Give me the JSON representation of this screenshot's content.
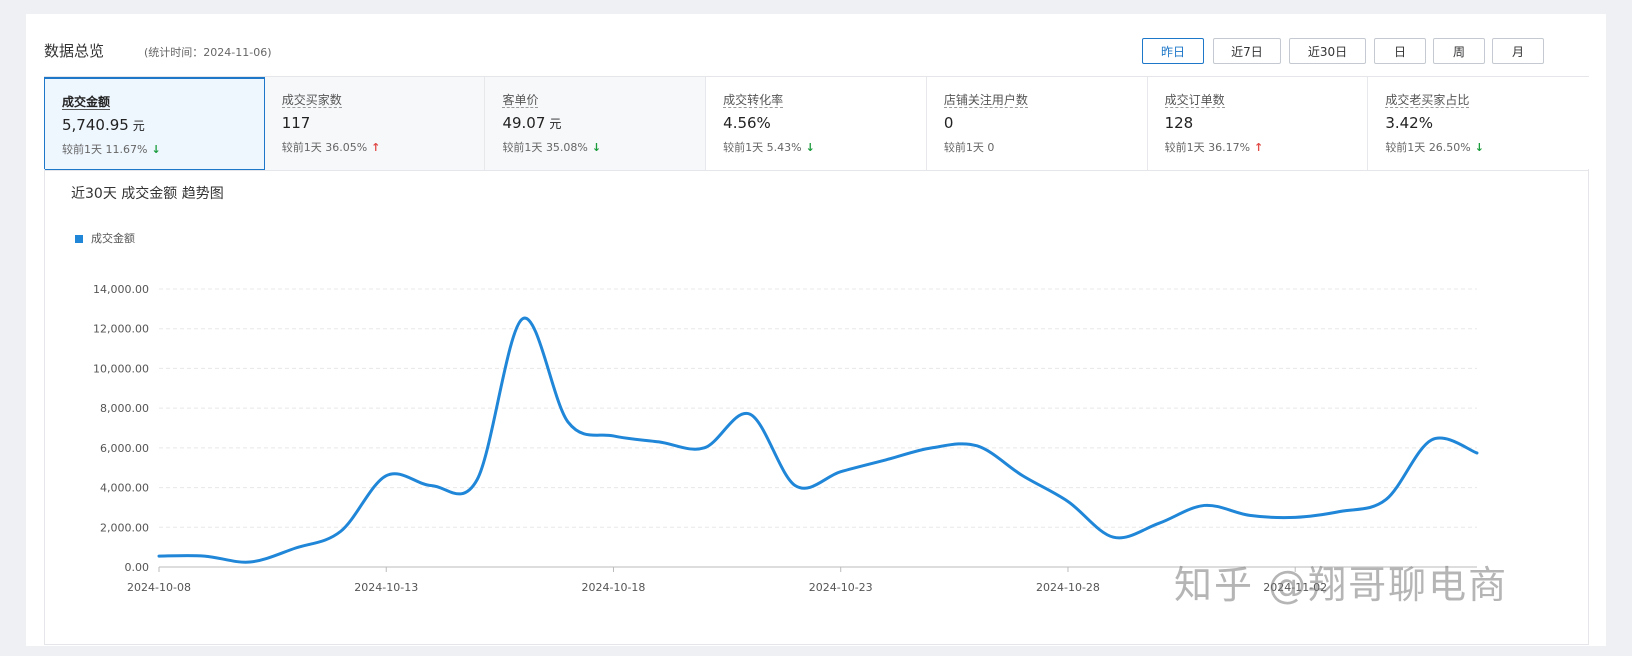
{
  "header": {
    "title": "数据总览",
    "subtitle": "(统计时间：2024-11-06)"
  },
  "range_buttons": [
    {
      "label": "昨日",
      "active": true
    },
    {
      "label": "近7日"
    },
    {
      "label": "近30日"
    },
    {
      "label": "日"
    },
    {
      "label": "周"
    },
    {
      "label": "月"
    }
  ],
  "metrics": [
    {
      "label": "成交金额",
      "value": "5,740.95",
      "unit": "元",
      "compare_prefix": "较前1天",
      "compare": "11.67%",
      "trend": "down",
      "active": true
    },
    {
      "label": "成交买家数",
      "value": "117",
      "unit": "",
      "compare_prefix": "较前1天",
      "compare": "36.05%",
      "trend": "up"
    },
    {
      "label": "客单价",
      "value": "49.07",
      "unit": "元",
      "compare_prefix": "较前1天",
      "compare": "35.08%",
      "trend": "down"
    },
    {
      "label": "成交转化率",
      "value": "4.56%",
      "unit": "",
      "compare_prefix": "较前1天",
      "compare": "5.43%",
      "trend": "down"
    },
    {
      "label": "店铺关注用户数",
      "value": "0",
      "unit": "",
      "compare_prefix": "较前1天",
      "compare": "0",
      "trend": "none"
    },
    {
      "label": "成交订单数",
      "value": "128",
      "unit": "",
      "compare_prefix": "较前1天",
      "compare": "36.17%",
      "trend": "up"
    },
    {
      "label": "成交老买家占比",
      "value": "3.42%",
      "unit": "",
      "compare_prefix": "较前1天",
      "compare": "26.50%",
      "trend": "down"
    }
  ],
  "icons": {
    "down": "arrow-down-icon",
    "up": "arrow-up-icon"
  },
  "colors": {
    "accent": "#1e77c8",
    "line": "#1f86d8",
    "down": "#1b9c3c",
    "up": "#e04a47"
  },
  "watermark": "知乎 @翔哥聊电商",
  "chart_data": {
    "type": "line",
    "title": "近30天 成交金额 趋势图",
    "legend_position": "top-left",
    "grid": true,
    "ylim": [
      0,
      14000
    ],
    "y_ticks": [
      "0.00",
      "2,000.00",
      "4,000.00",
      "6,000.00",
      "8,000.00",
      "10,000.00",
      "12,000.00",
      "14,000.00"
    ],
    "x_tick_labels": [
      "2024-10-08",
      "2024-10-13",
      "2024-10-18",
      "2024-10-23",
      "2024-10-28",
      "2024-11-02"
    ],
    "x": [
      "2024-10-08",
      "2024-10-09",
      "2024-10-10",
      "2024-10-11",
      "2024-10-12",
      "2024-10-13",
      "2024-10-14",
      "2024-10-15",
      "2024-10-16",
      "2024-10-17",
      "2024-10-18",
      "2024-10-19",
      "2024-10-20",
      "2024-10-21",
      "2024-10-22",
      "2024-10-23",
      "2024-10-24",
      "2024-10-25",
      "2024-10-26",
      "2024-10-27",
      "2024-10-28",
      "2024-10-29",
      "2024-10-30",
      "2024-10-31",
      "2024-11-01",
      "2024-11-02",
      "2024-11-03",
      "2024-11-04",
      "2024-11-05",
      "2024-11-06"
    ],
    "series": [
      {
        "name": "成交金额",
        "values": [
          550,
          550,
          250,
          950,
          1800,
          4600,
          4100,
          4400,
          12500,
          7300,
          6600,
          6300,
          6000,
          7700,
          4100,
          4800,
          5400,
          6000,
          6100,
          4600,
          3300,
          1500,
          2200,
          3100,
          2600,
          2500,
          2800,
          3400,
          6400,
          5740.95
        ]
      }
    ]
  }
}
